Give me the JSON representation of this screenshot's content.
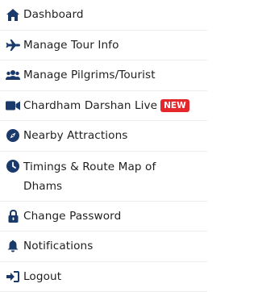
{
  "colors": {
    "icon": "#1a3a6b",
    "badge_bg": "#e5262a",
    "text": "#1f1f1f"
  },
  "menu": {
    "items": [
      {
        "label": "Dashboard",
        "icon": "home-icon"
      },
      {
        "label": "Manage Tour Info",
        "icon": "airplane-icon"
      },
      {
        "label": "Manage Pilgrims/Tourist",
        "icon": "users-icon"
      },
      {
        "label": "Chardham Darshan Live",
        "icon": "video-camera-icon",
        "badge": "NEW"
      },
      {
        "label": "Nearby Attractions",
        "icon": "compass-icon"
      },
      {
        "label": "Timings & Route Map of Dhams",
        "icon": "clock-icon"
      },
      {
        "label": "Change Password",
        "icon": "lock-icon"
      },
      {
        "label": "Notifications",
        "icon": "bell-icon"
      },
      {
        "label": "Logout",
        "icon": "logout-icon"
      }
    ]
  }
}
